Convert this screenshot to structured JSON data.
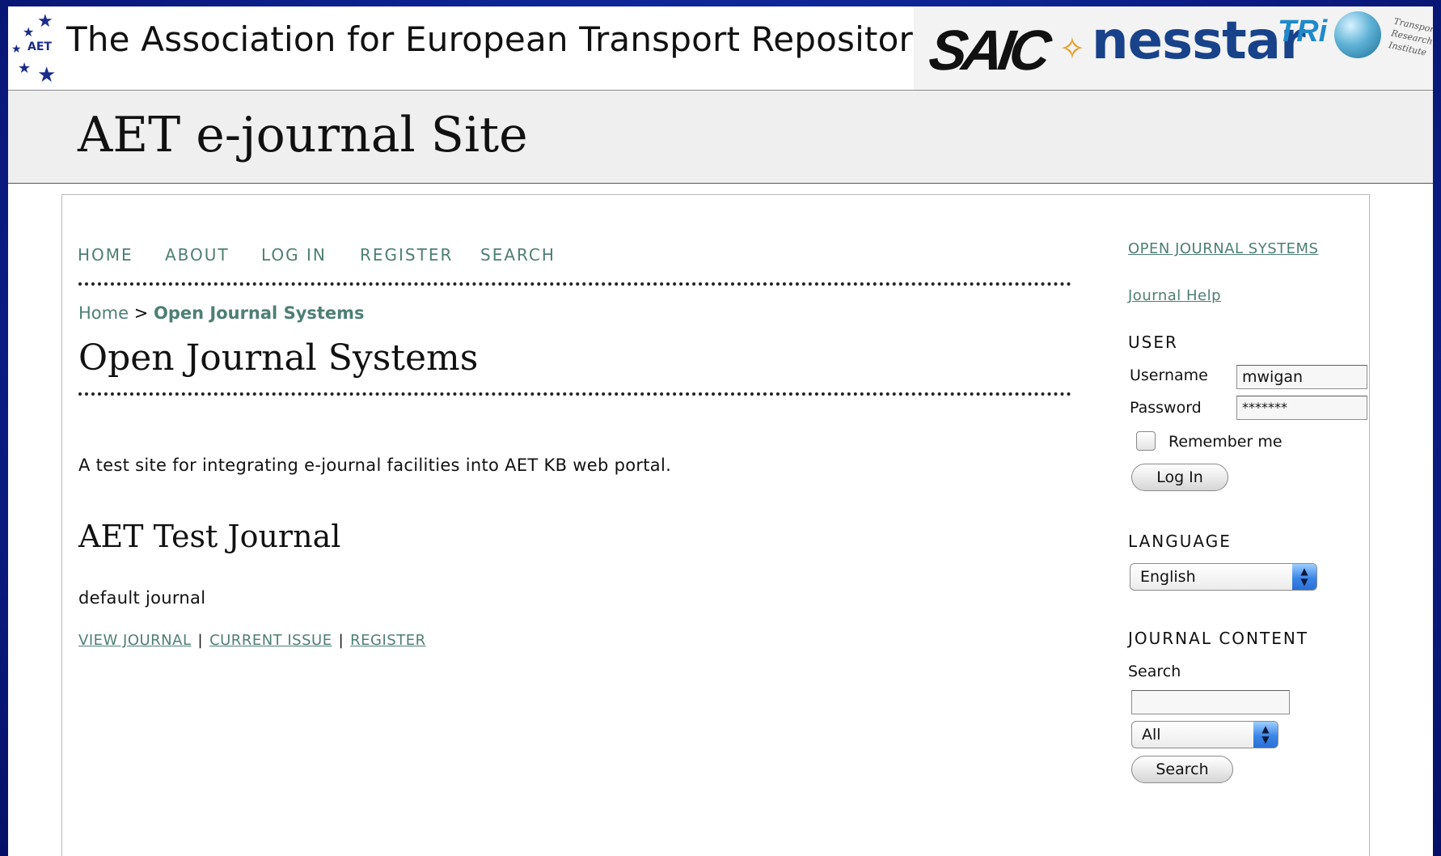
{
  "banner": {
    "title": "The Association for European Transport Repository",
    "aet_logo_text": "AET",
    "sponsor_saic": "SAIC",
    "sponsor_nesstar": "nesstar",
    "sponsor_tri": "TRi",
    "tri_text_line1": "Transport",
    "tri_text_line2": "Research",
    "tri_text_line3": "Institute"
  },
  "site": {
    "title": "AET e-journal Site"
  },
  "nav": {
    "items": [
      {
        "label": "HOME"
      },
      {
        "label": "ABOUT"
      },
      {
        "label": "LOG IN"
      },
      {
        "label": "REGISTER"
      },
      {
        "label": "SEARCH"
      }
    ]
  },
  "breadcrumb": {
    "home": "Home",
    "separator": ">",
    "current": "Open Journal Systems"
  },
  "main": {
    "page_title": "Open Journal Systems",
    "description": "A test site for integrating e-journal facilities into AET KB web portal.",
    "journal": {
      "title": "AET Test Journal",
      "description": "default journal",
      "links": [
        "VIEW JOURNAL",
        "CURRENT ISSUE",
        "REGISTER"
      ],
      "separator": "|"
    }
  },
  "sidebar": {
    "ojs_link": "OPEN JOURNAL SYSTEMS",
    "help_link": "Journal Help",
    "user": {
      "title": "USER",
      "username_label": "Username",
      "username_value": "mwigan",
      "password_label": "Password",
      "password_value": "*******",
      "remember_label": "Remember me",
      "login_button": "Log In"
    },
    "language": {
      "title": "LANGUAGE",
      "selected": "English"
    },
    "content": {
      "title": "JOURNAL CONTENT",
      "search_label": "Search",
      "search_value": "",
      "scope_selected": "All",
      "search_button": "Search"
    }
  },
  "colors": {
    "link": "#4d7f73",
    "desktop_bg": "#0d2290",
    "header_bg": "#efefef"
  }
}
